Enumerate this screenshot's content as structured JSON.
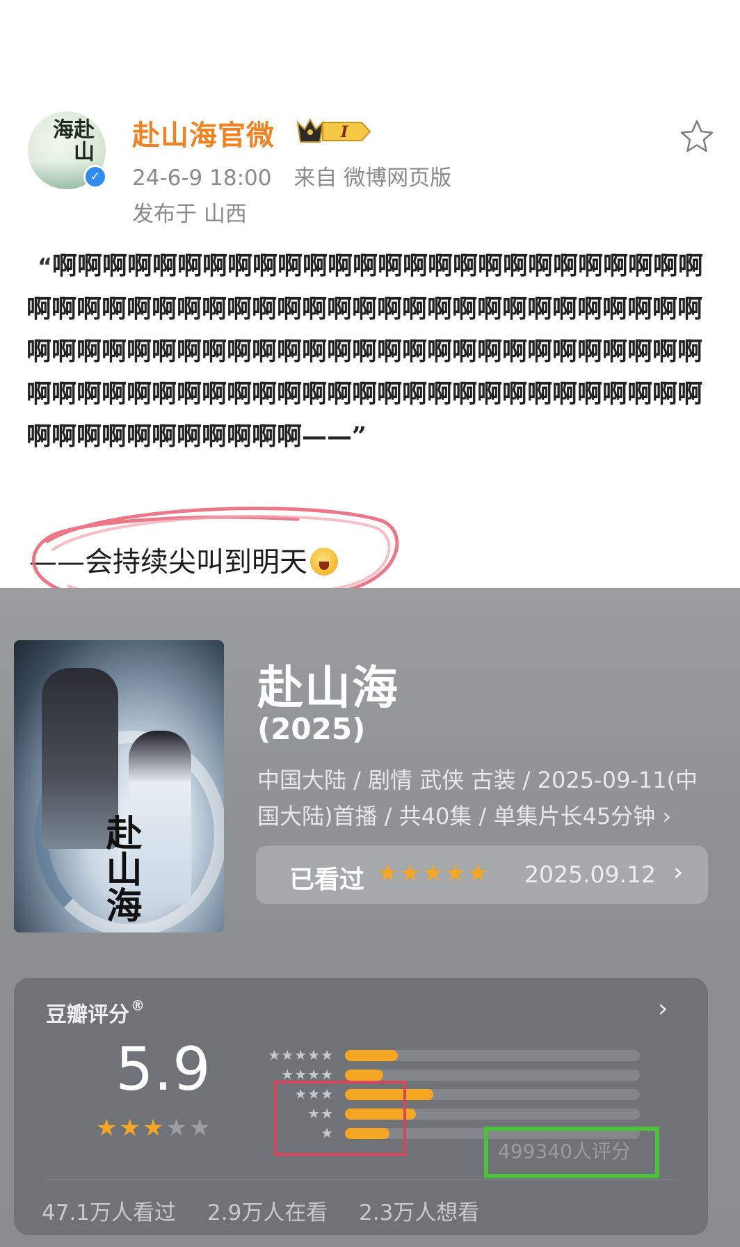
{
  "post": {
    "user_name": "赴山海官微",
    "vip_level": "I",
    "time": "24-6-9 18:00",
    "source": "来自 微博网页版",
    "location": "发布于 山西",
    "quote_open": "“",
    "text": "啊啊啊啊啊啊啊啊啊啊啊啊啊啊啊啊啊啊啊啊啊啊啊啊啊啊啊啊啊啊啊啊啊啊啊啊啊啊啊啊啊啊啊啊啊啊啊啊啊啊啊啊啊啊啊啊啊啊啊啊啊啊啊啊啊啊啊啊啊啊啊啊啊啊啊啊啊啊啊啊啊啊啊啊啊啊啊啊啊啊啊啊啊啊啊啊啊啊啊啊啊啊啊啊啊啊啊啊啊啊啊啊啊啊啊啊啊啊——”",
    "caption": "——会持续尖叫到明天"
  },
  "movie": {
    "title": "赴山海",
    "year": "(2025)",
    "info": "中国大陆 / 剧情 武侠 古装 / 2025-09-11(中国大陆)首播 / 共40集 / 单集片长45分钟 ›",
    "poster_title": "赴山海",
    "watched_label": "已看过",
    "watched_stars": "★★★★★",
    "watched_date": "2025.09.12",
    "watched_arrow": "›"
  },
  "rating": {
    "title": "豆瓣评分",
    "reg_mark": "®",
    "arrow": "›",
    "score": "5.9",
    "score_star_fraction": 0.6,
    "count": "499340人评分",
    "distribution": [
      {
        "stars": "★★★★★",
        "fraction": 0.18
      },
      {
        "stars": "★★★★",
        "fraction": 0.13
      },
      {
        "stars": "★★★",
        "fraction": 0.3
      },
      {
        "stars": "★★",
        "fraction": 0.24
      },
      {
        "stars": "★",
        "fraction": 0.15
      }
    ],
    "stats": [
      "47.1万人看过",
      "2.9万人在看",
      "2.3万人想看"
    ]
  },
  "colors": {
    "username": "#f08321",
    "accent_star": "#f5a623",
    "annotation_red": "#d9465b",
    "annotation_green": "#4cc23c"
  },
  "icons": {
    "favorite": "star-outline-icon",
    "verified": "verified-check-icon",
    "emoji": "laughing-face-icon"
  }
}
